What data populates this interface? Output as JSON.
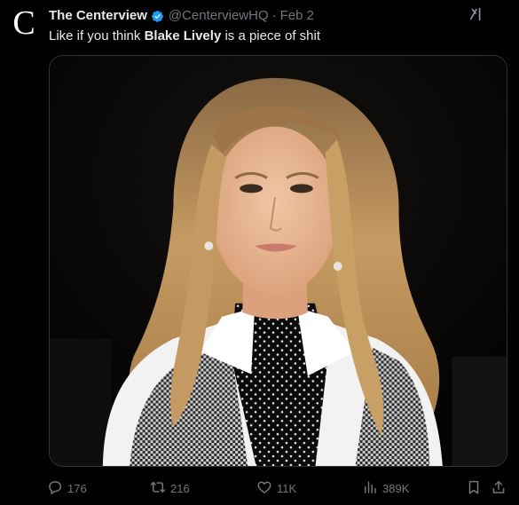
{
  "tweet": {
    "avatar_letter": "C",
    "display_name": "The Centerview",
    "handle": "@CenterviewHQ",
    "separator": "·",
    "date": "Feb 2",
    "text_before": "Like if you think ",
    "text_bold": "Blake Lively",
    "text_after": " is a piece of shit",
    "media_alt": "Photo of Blake Lively with long wavy blonde hair, white collared shirt with black polka-dot scarf and houndstooth vest, dark background"
  },
  "actions": {
    "replies": "176",
    "reposts": "216",
    "likes": "11K",
    "views": "389K"
  },
  "icons": {
    "verified": "verified-badge-icon",
    "grok": "grok-icon",
    "reply": "reply-icon",
    "repost": "repost-icon",
    "like": "heart-icon",
    "views": "views-chart-icon",
    "bookmark": "bookmark-icon",
    "share": "share-icon"
  },
  "colors": {
    "background": "#000000",
    "text_primary": "#e7e9ea",
    "text_secondary": "#71767b",
    "verified_blue": "#1d9bf0",
    "border": "#2f3336"
  }
}
